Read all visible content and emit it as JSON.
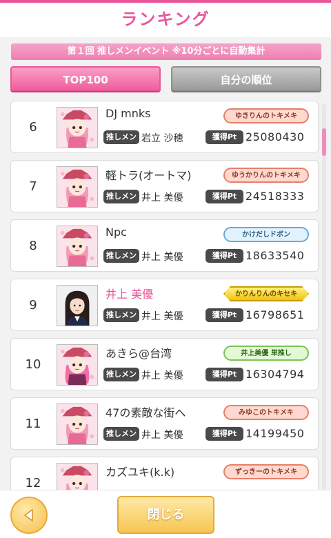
{
  "header": {
    "title": "ランキング"
  },
  "event": {
    "subtitle": "第１回 推しメンイベント ※10分ごとに自動集計"
  },
  "tabs": {
    "top100": "TOP100",
    "my_rank": "自分の順位"
  },
  "labels": {
    "oshimen": "推しメン",
    "points": "獲得Pt"
  },
  "rows": [
    {
      "rank": "6",
      "name": "DJ mnks",
      "oshimen": "岩立 沙穂",
      "points": "25080430",
      "badge": "ゆきりんのトキメキ",
      "badge_style": "salmon"
    },
    {
      "rank": "7",
      "name": "軽トラ(オートマ)",
      "oshimen": "井上 美優",
      "points": "24518333",
      "badge": "ゆうかりんのトキメキ",
      "badge_style": "salmon"
    },
    {
      "rank": "8",
      "name": "Npc",
      "oshimen": "井上 美優",
      "points": "18633540",
      "badge": "かけだしドボン",
      "badge_style": "blue"
    },
    {
      "rank": "9",
      "name": "井上 美優",
      "oshimen": "井上 美優",
      "points": "16798651",
      "badge": "かりんりんのキセキ",
      "badge_style": "gold"
    },
    {
      "rank": "10",
      "name": "あきら@台湾",
      "oshimen": "井上 美優",
      "points": "16304794",
      "badge": "井上美優 単推し",
      "badge_style": "green"
    },
    {
      "rank": "11",
      "name": "47の素敵な街へ",
      "oshimen": "井上 美優",
      "points": "14199450",
      "badge": "みゆこのトキメキ",
      "badge_style": "salmon"
    },
    {
      "rank": "12",
      "name": "カズユキ(k.k)",
      "oshimen": "",
      "points": "",
      "badge": "ずっきーのトキメキ",
      "badge_style": "salmon"
    }
  ],
  "footer": {
    "close": "閉じる"
  },
  "colors": {
    "accent": "#e8579a",
    "button_gold": "#f6c552"
  }
}
